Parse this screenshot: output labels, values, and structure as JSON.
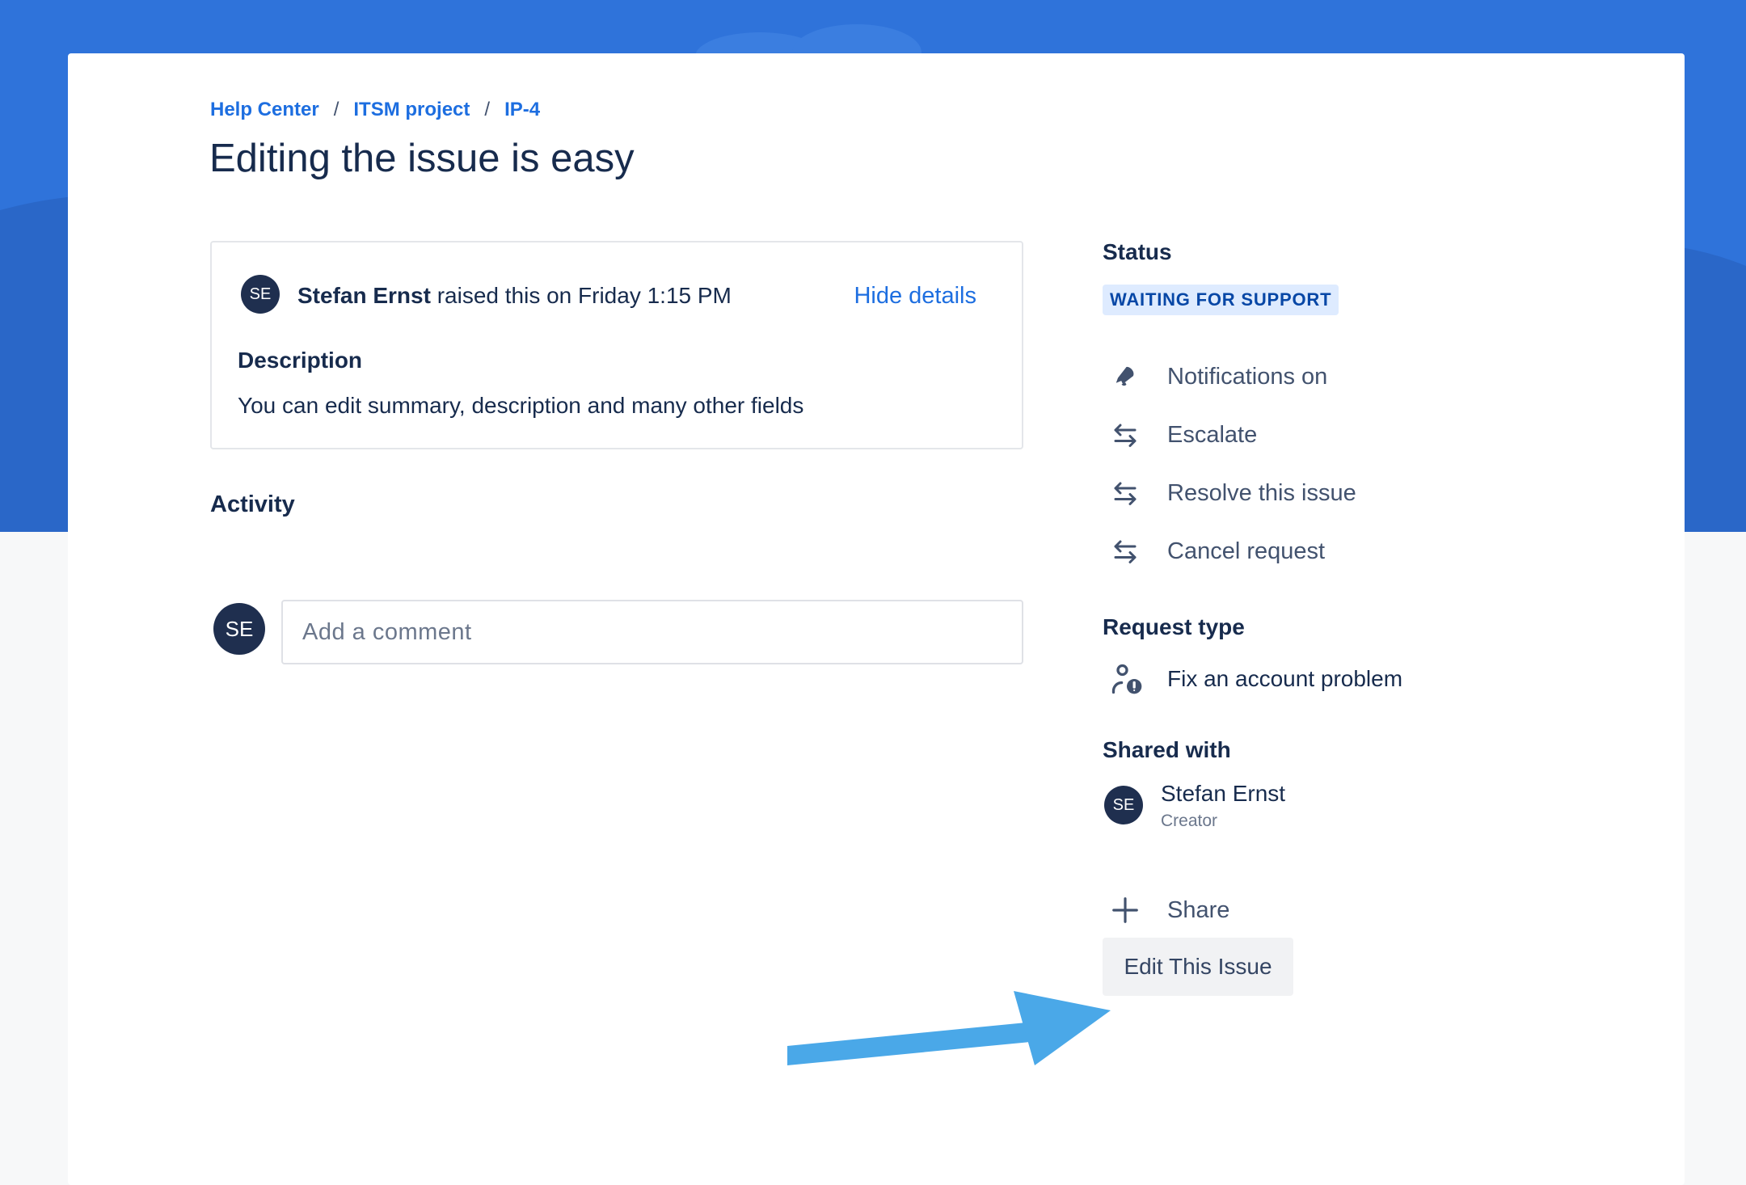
{
  "breadcrumb": [
    "Help Center",
    "ITSM project",
    "IP-4"
  ],
  "breadcrumb_separator": "/",
  "title": "Editing the issue is easy",
  "request": {
    "avatar_initials": "SE",
    "author": "Stefan Ernst",
    "raised_text": " raised this on Friday 1:15 PM",
    "hide_details_label": "Hide details",
    "description_label": "Description",
    "description": "You can edit summary, description and many other fields"
  },
  "activity": {
    "label": "Activity",
    "avatar_initials": "SE",
    "comment_placeholder": "Add a comment"
  },
  "sidebar": {
    "status_label": "Status",
    "status_value": "WAITING FOR SUPPORT",
    "actions": [
      {
        "label": "Notifications on",
        "icon": "bell-icon"
      },
      {
        "label": "Escalate",
        "icon": "transition-arrows-icon"
      },
      {
        "label": "Resolve this issue",
        "icon": "transition-arrows-icon"
      },
      {
        "label": "Cancel request",
        "icon": "transition-arrows-icon"
      }
    ],
    "request_type_label": "Request type",
    "request_type_value": "Fix an account problem",
    "shared_with_label": "Shared with",
    "shared_user": {
      "initials": "SE",
      "name": "Stefan Ernst",
      "role": "Creator"
    },
    "share_label": "Share",
    "edit_button_label": "Edit This Issue"
  },
  "colors": {
    "header_band": "#2f73da",
    "link": "#1d6ee0",
    "avatar": "#1f2f4f",
    "status_bg": "#deebff",
    "status_text": "#0747a6",
    "annotation_arrow": "#4aa8e8"
  }
}
